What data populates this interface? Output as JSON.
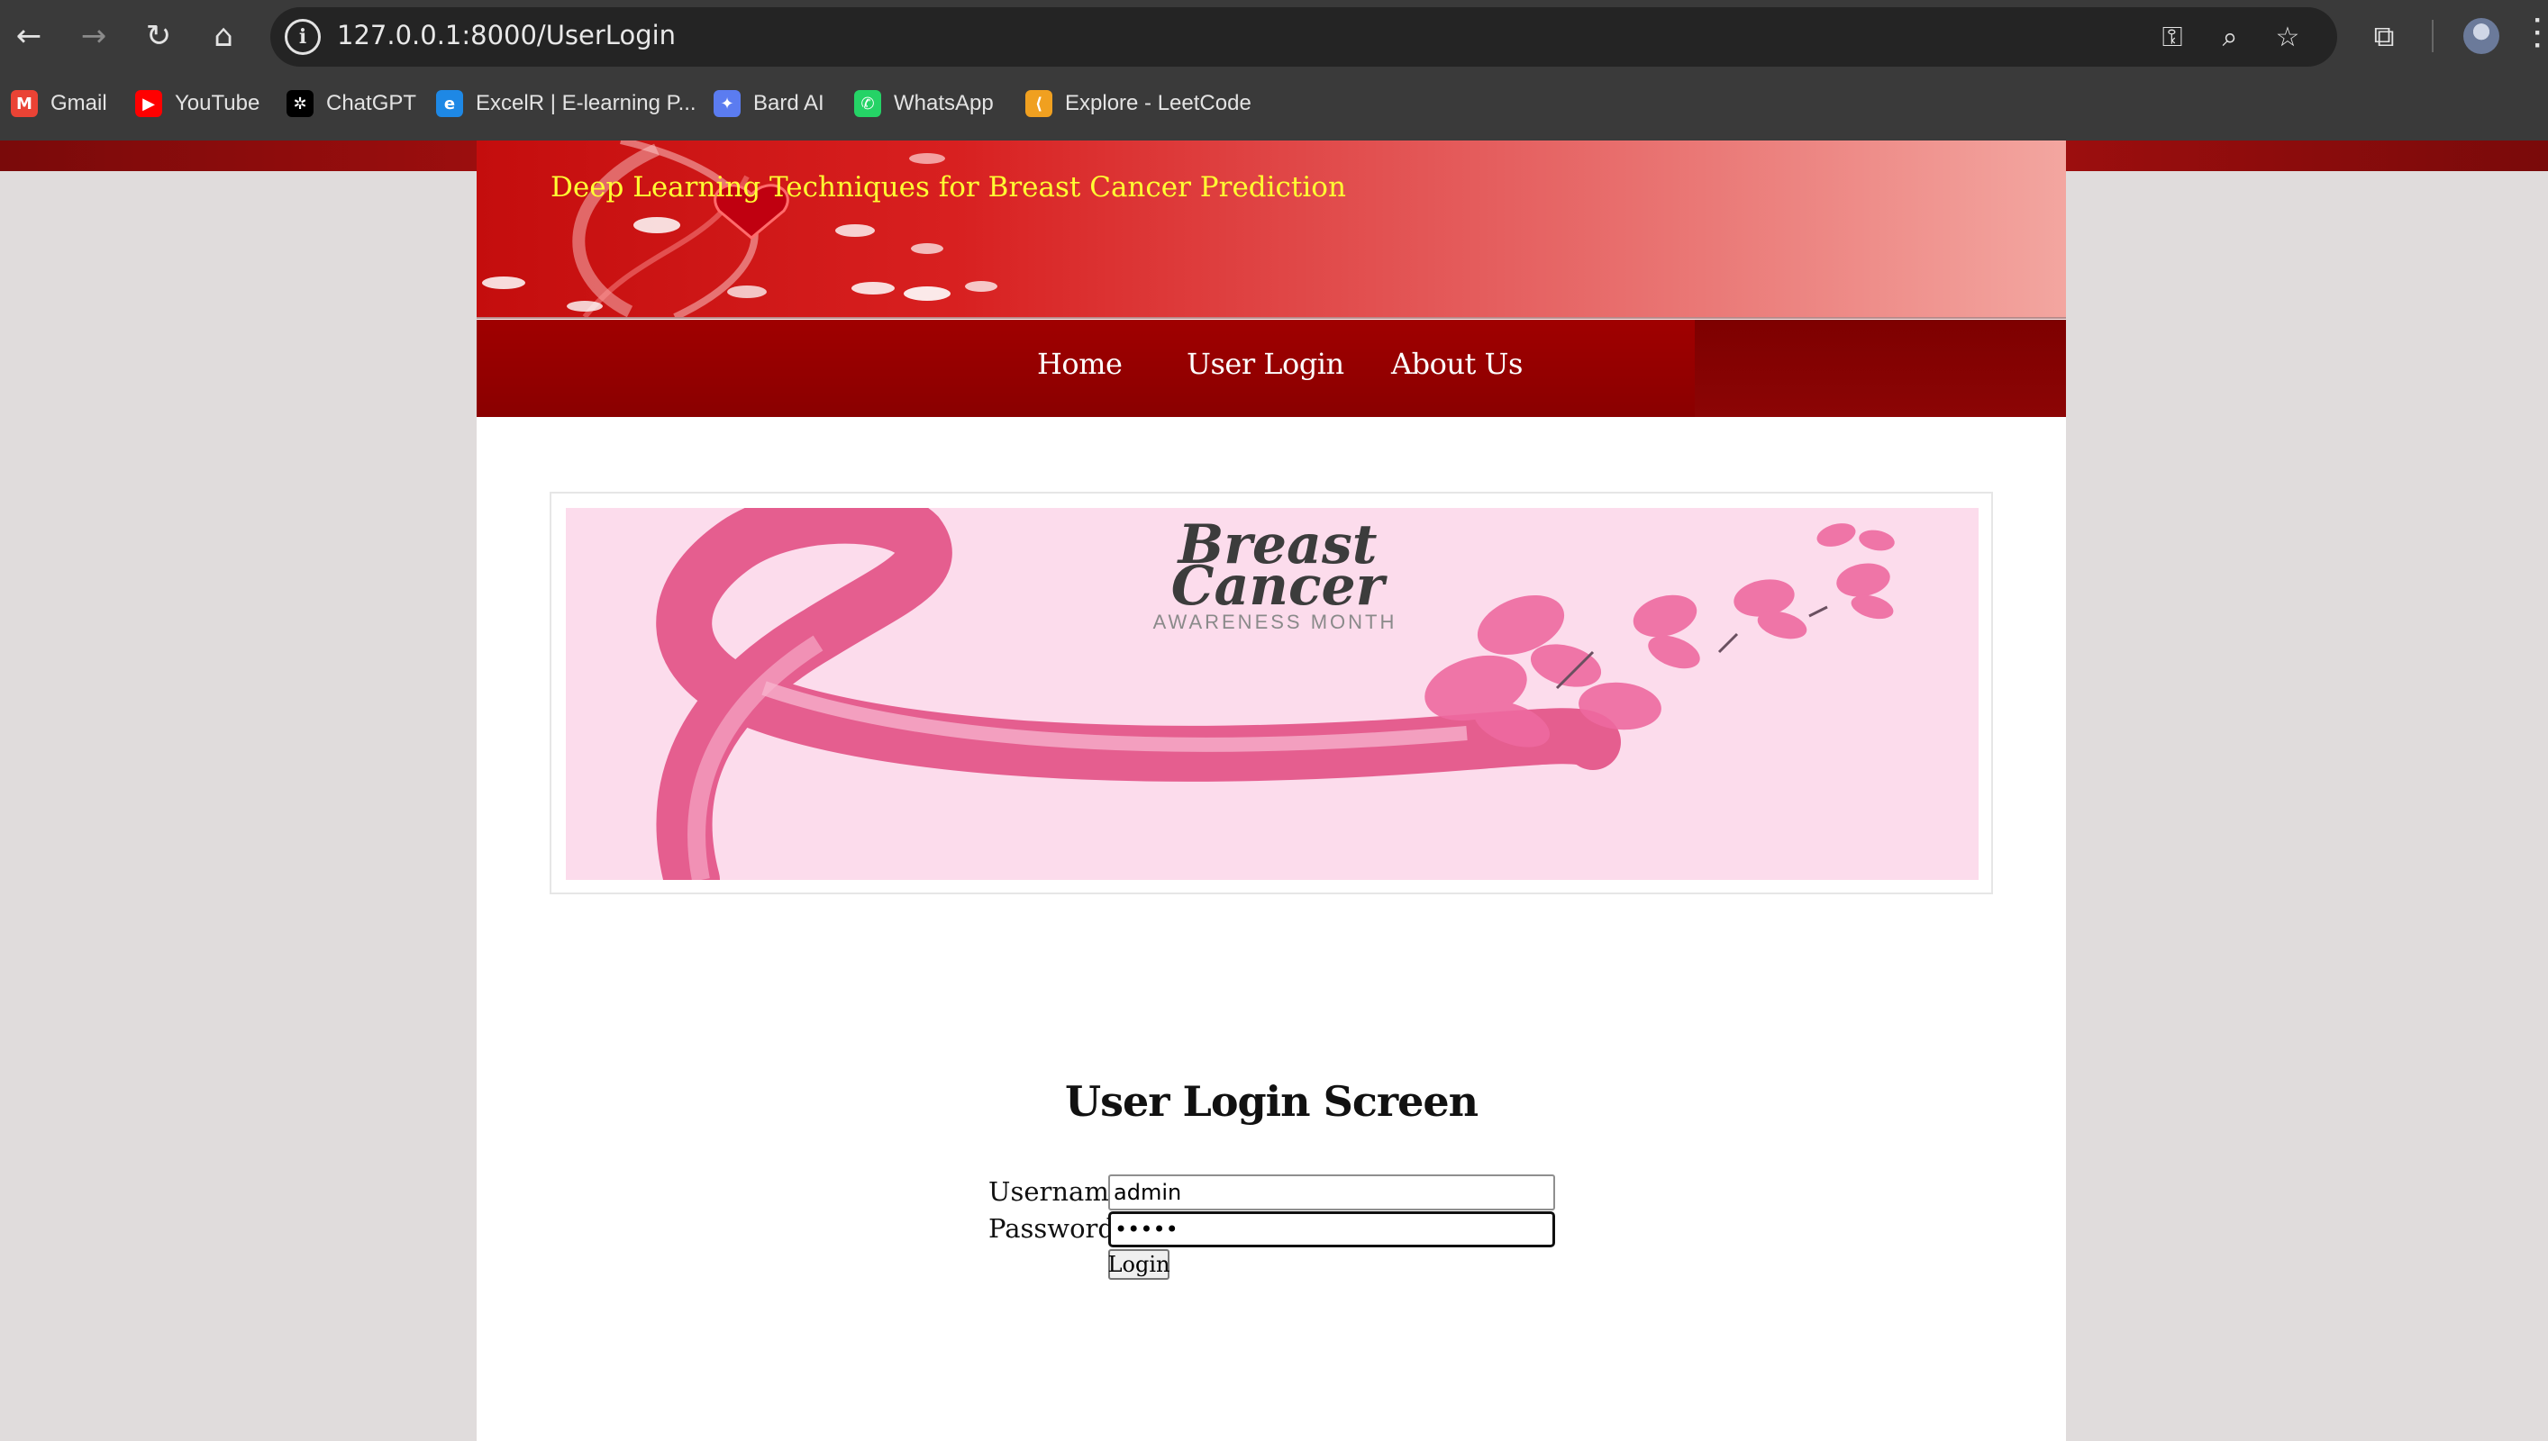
{
  "browser": {
    "url": "127.0.0.1:8000/UserLogin",
    "bookmarks": [
      {
        "label": "Gmail",
        "icon": "gmail-icon",
        "color": "#ea4335",
        "glyph": "M"
      },
      {
        "label": "YouTube",
        "icon": "youtube-icon",
        "color": "#ff0000",
        "glyph": "▶"
      },
      {
        "label": "ChatGPT",
        "icon": "chatgpt-icon",
        "color": "#000000",
        "glyph": "✲"
      },
      {
        "label": "ExcelR | E-learning P...",
        "icon": "excelr-icon",
        "color": "#1e88e5",
        "glyph": "e"
      },
      {
        "label": "Bard AI",
        "icon": "bard-icon",
        "color": "#5b7cf0",
        "glyph": "✦"
      },
      {
        "label": "WhatsApp",
        "icon": "whatsapp-icon",
        "color": "#25d366",
        "glyph": "✆"
      },
      {
        "label": "Explore - LeetCode",
        "icon": "leetcode-icon",
        "color": "#f0a020",
        "glyph": "⟨"
      }
    ]
  },
  "site": {
    "title": "Deep Learning Techniques for Breast Cancer Prediction",
    "nav": [
      {
        "label": "Home"
      },
      {
        "label": "User Login"
      },
      {
        "label": "About Us"
      }
    ],
    "hero": {
      "title_line1": "Breast",
      "title_line2": "Cancer",
      "subtitle": "AWARENESS MONTH"
    }
  },
  "login": {
    "heading": "User Login Screen",
    "username_label": "Username",
    "username_value": "admin",
    "password_label": "Password",
    "password_value": "admin",
    "button_label": "Login"
  },
  "colors": {
    "accent_red": "#a00000",
    "title_yellow": "#ffff33",
    "hero_pink": "#fcdcec",
    "ribbon_pink": "#e8488a"
  }
}
